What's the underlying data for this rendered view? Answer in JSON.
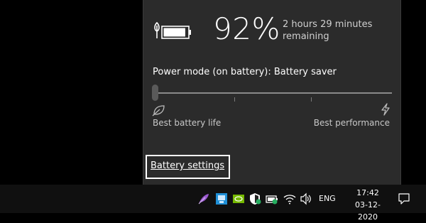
{
  "battery": {
    "percent": "92%",
    "remaining": "2 hours 29 minutes remaining",
    "level": 0.92
  },
  "power": {
    "mode_label": "Power mode (on battery): Battery saver",
    "slider_value": 0,
    "left_label": "Best battery life",
    "right_label": "Best performance"
  },
  "settings_link": "Battery settings",
  "taskbar": {
    "language": "ENG",
    "time": "17:42",
    "date": "03-12-2020",
    "tray_icons": [
      "feather-icon",
      "app-icon",
      "nvidia-icon",
      "security-shield-icon",
      "battery-plug-icon",
      "wifi-icon",
      "speaker-icon"
    ]
  },
  "colors": {
    "flyout_bg": "#2b2b2b",
    "taskbar_bg": "#101010"
  }
}
